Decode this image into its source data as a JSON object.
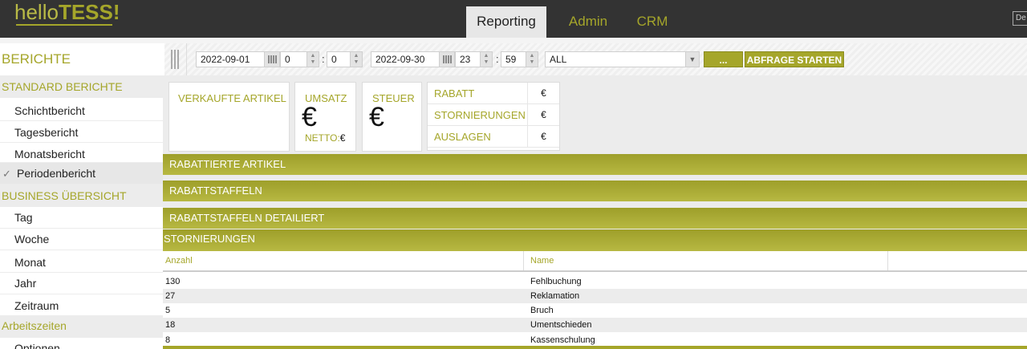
{
  "header": {
    "logo_light": "hello",
    "logo_bold": "TESS!",
    "tabs": [
      {
        "label": "Reporting",
        "active": true
      },
      {
        "label": "Admin",
        "active": false
      },
      {
        "label": "CRM",
        "active": false
      }
    ],
    "lang": "De"
  },
  "filter": {
    "section_title": "BERICHTE",
    "date_from": "2022-09-01",
    "hour_from": "0",
    "minute_from": "0",
    "date_to": "2022-09-30",
    "hour_to": "23",
    "minute_to": "59",
    "colon": ":",
    "select_value": "ALL",
    "more_label": "...",
    "start_label": "ABFRAGE STARTEN"
  },
  "sidebar": {
    "sections": [
      {
        "title": "STANDARD BERICHTE",
        "items": [
          "Schichtbericht",
          "Tagesbericht",
          "Monatsbericht",
          "Periodenbericht"
        ],
        "active_item": "Periodenbericht"
      },
      {
        "title": "BUSINESS ÜBERSICHT",
        "items": [
          "Tag",
          "Woche",
          "Monat",
          "Jahr",
          "Zeitraum"
        ]
      },
      {
        "title": "Arbeitszeiten",
        "items": [
          "Optionen"
        ]
      }
    ],
    "check_glyph": "✓"
  },
  "summary": {
    "verkaufte_artikel": "VERKAUFTE ARTIKEL",
    "umsatz": "UMSATZ",
    "steuer": "STEUER",
    "euro": "€",
    "netto_label": "NETTO:",
    "netto_value": "€",
    "rows": [
      {
        "label": "RABATT",
        "value": "€"
      },
      {
        "label": "STORNIERUNGEN",
        "value": "€"
      },
      {
        "label": "AUSLAGEN",
        "value": "€"
      }
    ]
  },
  "bands": {
    "rabattierte": "RABATTIERTE ARTIKEL",
    "staffeln": "RABATTSTAFFELN",
    "staffeln_detail": "RABATTSTAFFELN DETAILIERT",
    "stornierungen": "STORNIERUNGEN"
  },
  "stornierungen_table": {
    "columns": [
      "Anzahl",
      "Name"
    ],
    "rows": [
      {
        "anzahl": "130",
        "name": "Fehlbuchung"
      },
      {
        "anzahl": "27",
        "name": "Reklamation"
      },
      {
        "anzahl": "5",
        "name": "Bruch"
      },
      {
        "anzahl": "18",
        "name": "Umentschieden"
      },
      {
        "anzahl": "8",
        "name": "Kassenschulung"
      }
    ]
  },
  "colors": {
    "accent": "#a5a62a",
    "topbar": "#333333"
  }
}
